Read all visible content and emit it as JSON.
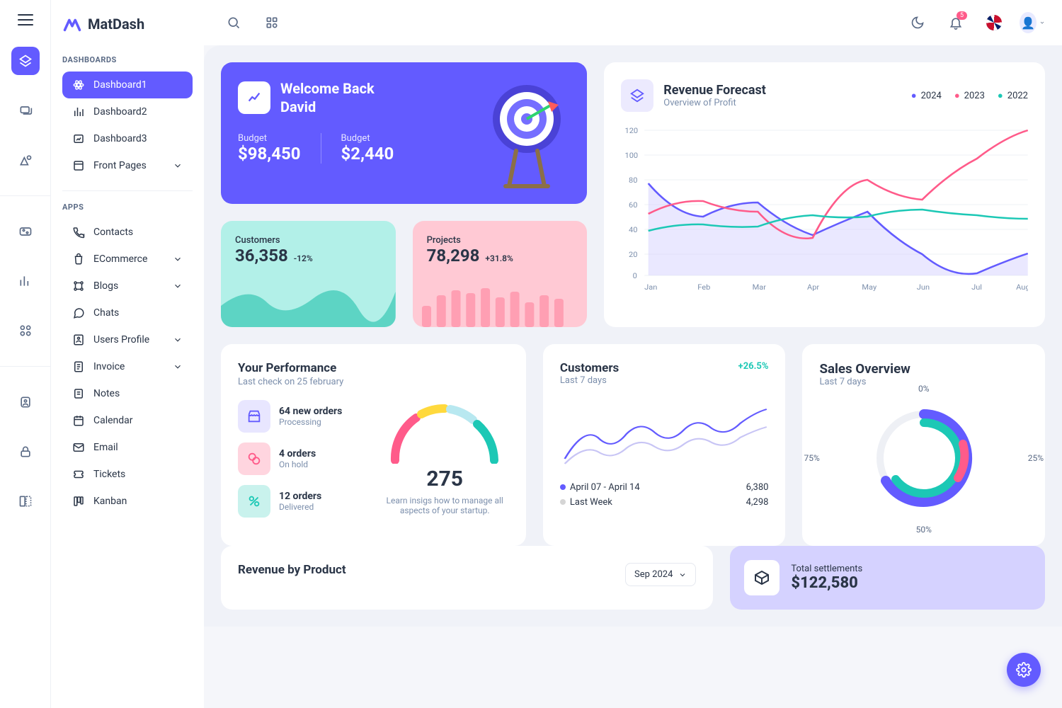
{
  "brand": "MatDash",
  "notification_count": "5",
  "sidebar": {
    "section1": "DASHBOARDS",
    "section2": "APPS",
    "items1": [
      "Dashboard1",
      "Dashboard2",
      "Dashboard3",
      "Front Pages"
    ],
    "items2": [
      "Contacts",
      "ECommerce",
      "Blogs",
      "Chats",
      "Users Profile",
      "Invoice",
      "Notes",
      "Calendar",
      "Email",
      "Tickets",
      "Kanban"
    ]
  },
  "welcome": {
    "line1": "Welcome Back",
    "line2": "David",
    "budget1_lbl": "Budget",
    "budget1_val": "$98,450",
    "budget2_lbl": "Budget",
    "budget2_val": "$2,440"
  },
  "mini": {
    "customers_lbl": "Customers",
    "customers_val": "36,358",
    "customers_delta": "-12%",
    "projects_lbl": "Projects",
    "projects_val": "78,298",
    "projects_delta": "+31.8%"
  },
  "revenue": {
    "title": "Revenue Forecast",
    "subtitle": "Overview of Profit",
    "legend": [
      "2024",
      "2023",
      "2022"
    ]
  },
  "perf": {
    "title": "Your Performance",
    "subtitle": "Last check on 25 february",
    "i1_t": "64 new orders",
    "i1_s": "Processing",
    "i2_t": "4 orders",
    "i2_s": "On hold",
    "i3_t": "12 orders",
    "i3_s": "Delivered",
    "gauge_val": "275",
    "gauge_sub": "Learn insigs how to manage all aspects of your startup."
  },
  "cust": {
    "title": "Customers",
    "subtitle": "Last 7 days",
    "delta": "+26.5%",
    "l1_lbl": "April 07 - April 14",
    "l1_val": "6,380",
    "l2_lbl": "Last Week",
    "l2_val": "4,298"
  },
  "sales": {
    "title": "Sales Overview",
    "subtitle": "Last 7 days",
    "pcts": [
      "0%",
      "25%",
      "50%",
      "75%"
    ]
  },
  "rbp": {
    "title": "Revenue by Product",
    "select": "Sep 2024"
  },
  "settle": {
    "lbl": "Total settlements",
    "val": "$122,580"
  },
  "chart_data": [
    {
      "type": "line",
      "title": "Revenue Forecast",
      "categories": [
        "Jan",
        "Feb",
        "Mar",
        "Apr",
        "May",
        "Jun",
        "Jul",
        "Aug"
      ],
      "ylim": [
        0,
        120
      ],
      "series": [
        {
          "name": "2024",
          "values": [
            74,
            48,
            60,
            33,
            52,
            18,
            2,
            18
          ]
        },
        {
          "name": "2023",
          "values": [
            50,
            60,
            52,
            30,
            78,
            62,
            94,
            120
          ]
        },
        {
          "name": "2022",
          "values": [
            36,
            42,
            40,
            50,
            48,
            54,
            50,
            46
          ]
        }
      ]
    },
    {
      "type": "line",
      "title": "Customers Last 7 days",
      "series": [
        {
          "name": "April 07 - April 14",
          "values": [
            10,
            45,
            30,
            50,
            35,
            55,
            48,
            60,
            55,
            70
          ]
        },
        {
          "name": "Last Week",
          "values": [
            5,
            25,
            12,
            35,
            22,
            40,
            30,
            42,
            38,
            48
          ]
        }
      ]
    },
    {
      "type": "pie",
      "title": "Sales Overview",
      "slices": [
        {
          "name": "blue",
          "value": 55
        },
        {
          "name": "teal",
          "value": 35
        },
        {
          "name": "pink",
          "value": 10
        }
      ]
    }
  ]
}
